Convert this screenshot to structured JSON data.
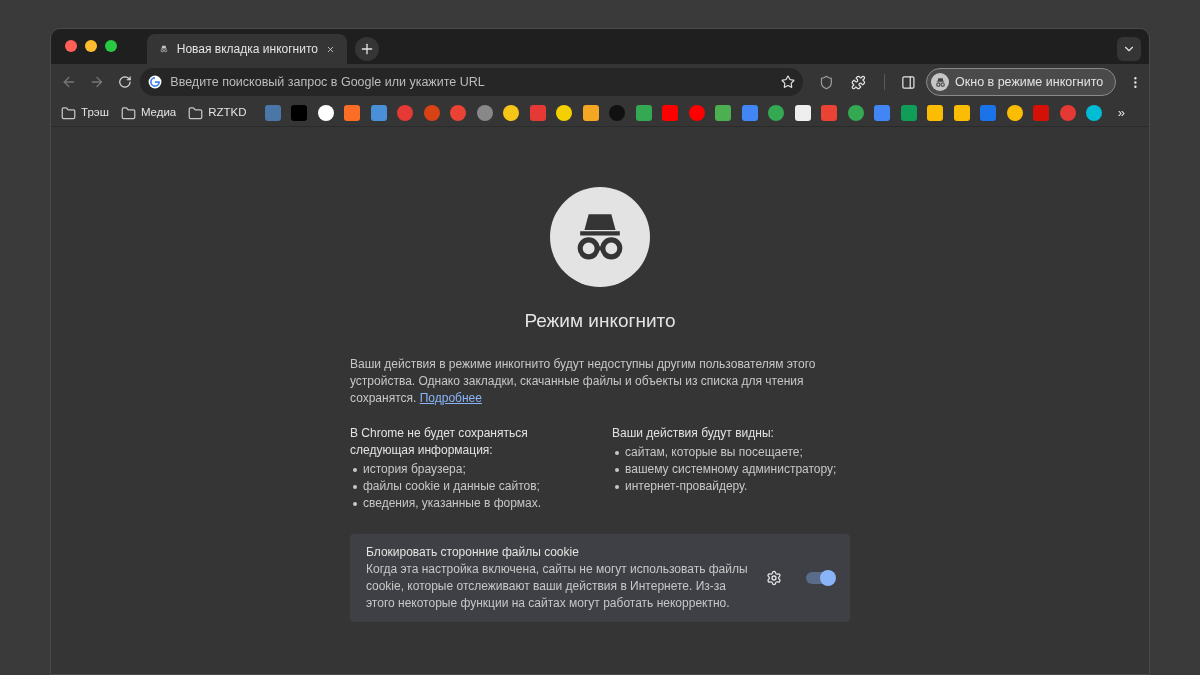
{
  "tab": {
    "title": "Новая вкладка инкогнито",
    "selected": true
  },
  "omnibox": {
    "placeholder": "Введите поисковый запрос в Google или укажите URL"
  },
  "profile_chip": {
    "label": "Окно в режиме инкогнито"
  },
  "bookmarks": {
    "folders": [
      "Трэш",
      "Медиа",
      "RZTKD"
    ],
    "favicons": [
      {
        "kind": "square",
        "color": "#4a76a8"
      },
      {
        "kind": "square",
        "color": "#000000"
      },
      {
        "kind": "circle",
        "color": "#ffffff"
      },
      {
        "kind": "square",
        "color": "#fc6d26"
      },
      {
        "kind": "square",
        "color": "#4a90d9"
      },
      {
        "kind": "circle",
        "color": "#e53935"
      },
      {
        "kind": "circle",
        "color": "#d84315"
      },
      {
        "kind": "circle",
        "color": "#ea4335"
      },
      {
        "kind": "circle",
        "color": "#888888"
      },
      {
        "kind": "circle",
        "color": "#f5c518"
      },
      {
        "kind": "square",
        "color": "#e53935"
      },
      {
        "kind": "circle",
        "color": "#f5d000"
      },
      {
        "kind": "square",
        "color": "#f5a623"
      },
      {
        "kind": "circle",
        "color": "#111111"
      },
      {
        "kind": "square",
        "color": "#34a853"
      },
      {
        "kind": "square",
        "color": "#ff0000"
      },
      {
        "kind": "circle",
        "color": "#ff0000"
      },
      {
        "kind": "square",
        "color": "#4caf50"
      },
      {
        "kind": "square",
        "color": "#4285f4"
      },
      {
        "kind": "circle",
        "color": "#34a853"
      },
      {
        "kind": "square",
        "color": "#eeeeee"
      },
      {
        "kind": "square",
        "color": "#ea4335"
      },
      {
        "kind": "circle",
        "color": "#34a853"
      },
      {
        "kind": "square",
        "color": "#4285f4"
      },
      {
        "kind": "square",
        "color": "#0f9d58"
      },
      {
        "kind": "square",
        "color": "#fbbc04"
      },
      {
        "kind": "square",
        "color": "#fbbc04"
      },
      {
        "kind": "square",
        "color": "#1a73e8"
      },
      {
        "kind": "circle",
        "color": "#fbbc04"
      },
      {
        "kind": "square",
        "color": "#d51007"
      },
      {
        "kind": "circle",
        "color": "#e53935"
      },
      {
        "kind": "circle",
        "color": "#00bcd4"
      }
    ],
    "overflow": "»"
  },
  "page": {
    "title": "Режим инкогнито",
    "intro": "Ваши действия в режиме инкогнито будут недоступны другим пользователям этого устройства. Однако закладки, скачанные файлы и объекты из списка для чтения сохранятся.",
    "link": "Подробнее",
    "columns": [
      {
        "heading": "В Chrome не будет сохраняться следующая информация:",
        "items": [
          "история браузера;",
          "файлы cookie и данные сайтов;",
          "сведения, указанные в формах."
        ]
      },
      {
        "heading": "Ваши действия будут видны:",
        "items": [
          "сайтам, которые вы посещаете;",
          "вашему системному администратору;",
          "интернет-провайдеру."
        ]
      }
    ],
    "cookie_card": {
      "title": "Блокировать сторонние файлы cookie",
      "description": "Когда эта настройка включена, сайты не могут использовать файлы cookie, которые отслеживают ваши действия в Интернете. Из-за этого некоторые функции на сайтах могут работать некорректно.",
      "on": true
    }
  }
}
